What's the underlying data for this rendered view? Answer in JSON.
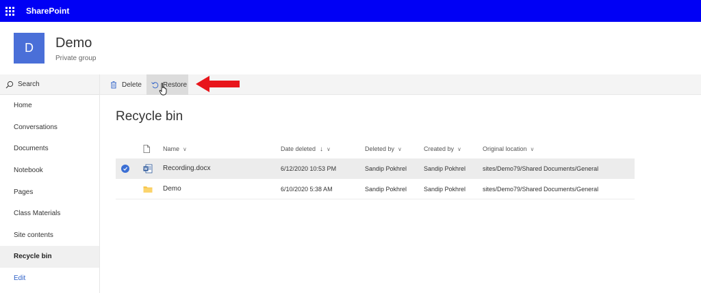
{
  "suitebar": {
    "brand": "SharePoint"
  },
  "site": {
    "logo_letter": "D",
    "title": "Demo",
    "subtitle": "Private group"
  },
  "leftnav": {
    "search_label": "Search",
    "items": [
      {
        "label": "Home"
      },
      {
        "label": "Conversations"
      },
      {
        "label": "Documents"
      },
      {
        "label": "Notebook"
      },
      {
        "label": "Pages"
      },
      {
        "label": "Class Materials"
      },
      {
        "label": "Site contents"
      },
      {
        "label": "Recycle bin",
        "selected": true
      }
    ],
    "edit_label": "Edit"
  },
  "commandbar": {
    "delete_label": "Delete",
    "restore_label": "Restore"
  },
  "page": {
    "title": "Recycle bin"
  },
  "table": {
    "columns": {
      "name": "Name",
      "date_deleted": "Date deleted",
      "deleted_by": "Deleted by",
      "created_by": "Created by",
      "original_location": "Original location"
    },
    "rows": [
      {
        "icon": "word-document-icon",
        "name": "Recording.docx",
        "date_deleted": "6/12/2020 10:53 PM",
        "deleted_by": "Sandip Pokhrel",
        "created_by": "Sandip Pokhrel",
        "original_location": "sites/Demo79/Shared Documents/General",
        "selected": true
      },
      {
        "icon": "folder-icon",
        "name": "Demo",
        "date_deleted": "6/10/2020 5:38 AM",
        "deleted_by": "Sandip Pokhrel",
        "created_by": "Sandip Pokhrel",
        "original_location": "sites/Demo79/Shared Documents/General",
        "selected": false
      }
    ]
  },
  "colors": {
    "suitebar": "#0000f5",
    "site_logo": "#4a6fd8",
    "annotation_arrow": "#e8151b",
    "selection_check": "#3b6fd4"
  }
}
